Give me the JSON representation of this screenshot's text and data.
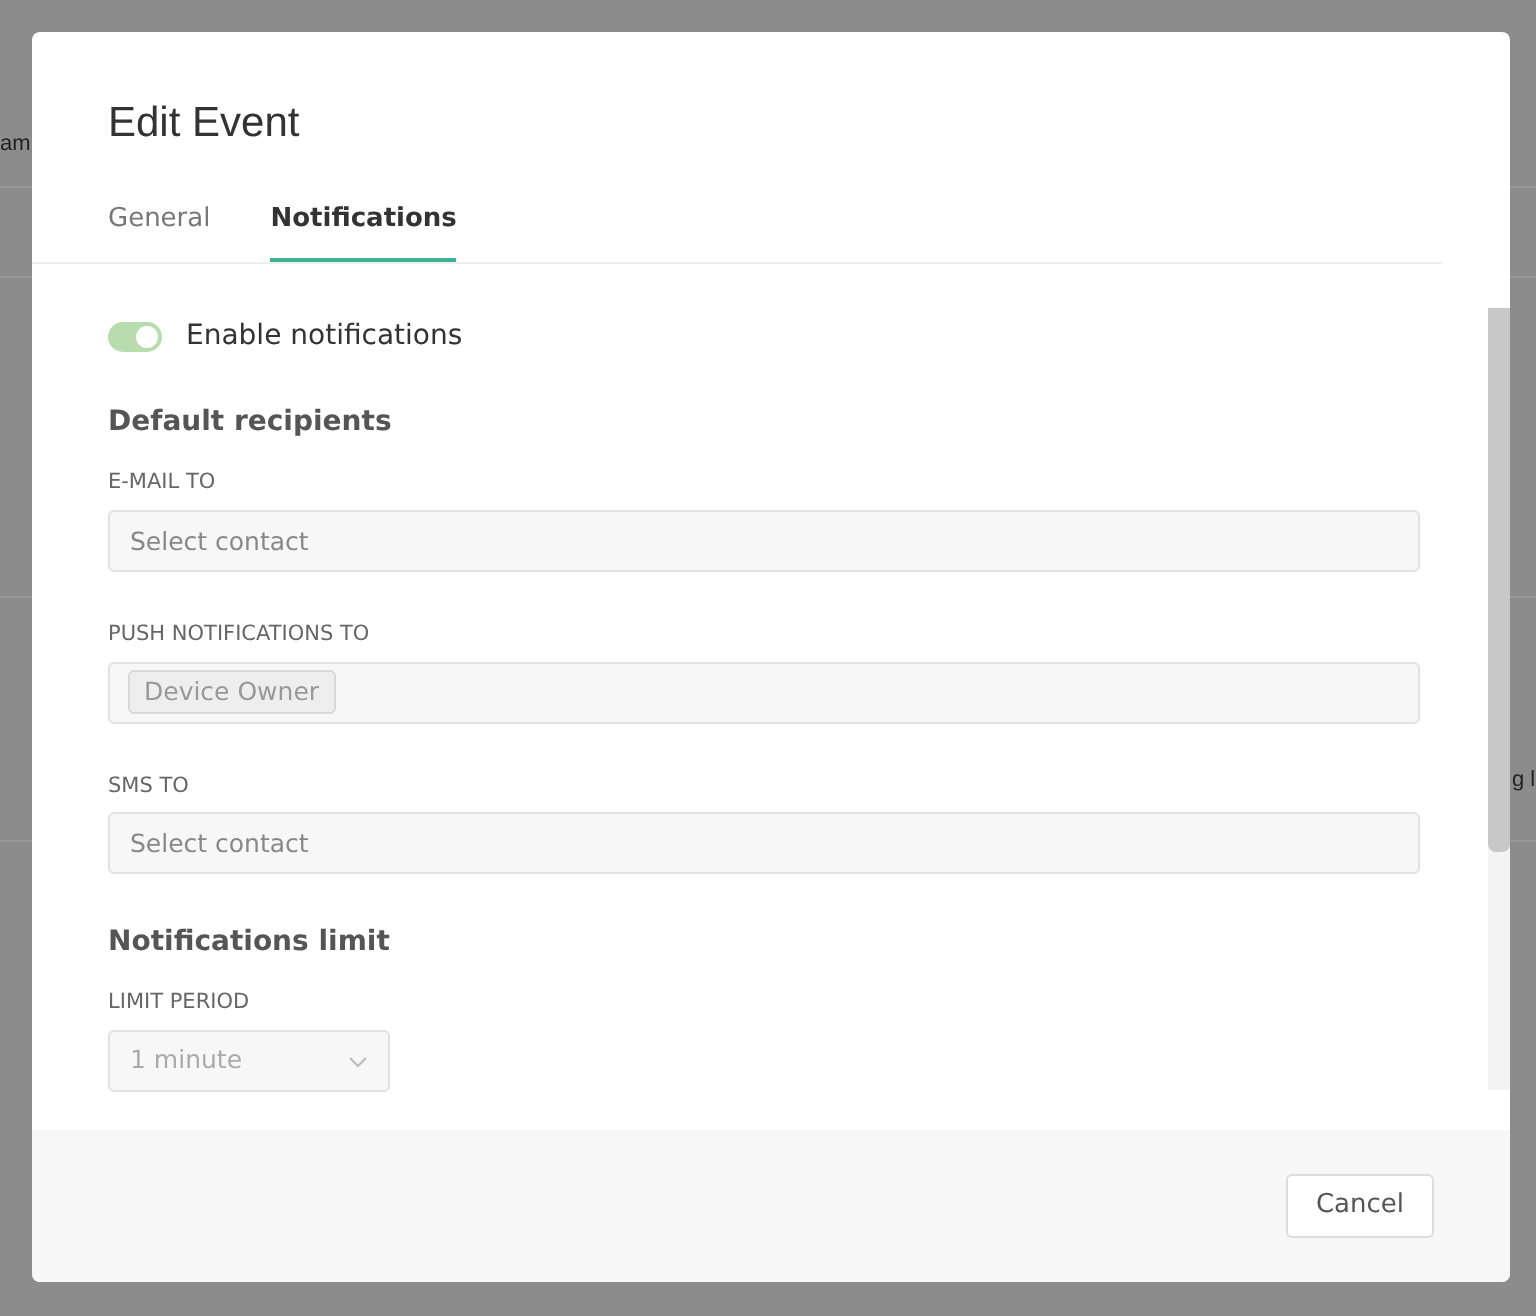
{
  "background": {
    "fragments": [
      "am",
      "g l"
    ]
  },
  "dialog": {
    "title": "Edit Event",
    "tabs": [
      {
        "label": "General",
        "selected": false
      },
      {
        "label": "Notifications",
        "selected": true
      }
    ],
    "toggle": {
      "label": "Enable notifications",
      "on": true
    },
    "sections": [
      {
        "heading": "Default recipients",
        "fields": [
          {
            "kind": "select",
            "label": "E-MAIL TO",
            "placeholder": "Select contact"
          },
          {
            "kind": "tags",
            "label": "PUSH NOTIFICATIONS TO",
            "tags": [
              "Device Owner"
            ]
          },
          {
            "kind": "select",
            "label": "SMS TO",
            "placeholder": "Select contact"
          }
        ]
      },
      {
        "heading": "Notifications limit",
        "fields": [
          {
            "kind": "dropdown",
            "label": "LIMIT PERIOD",
            "value": "1 minute"
          }
        ]
      }
    ],
    "buttons": [
      "Cancel"
    ]
  }
}
